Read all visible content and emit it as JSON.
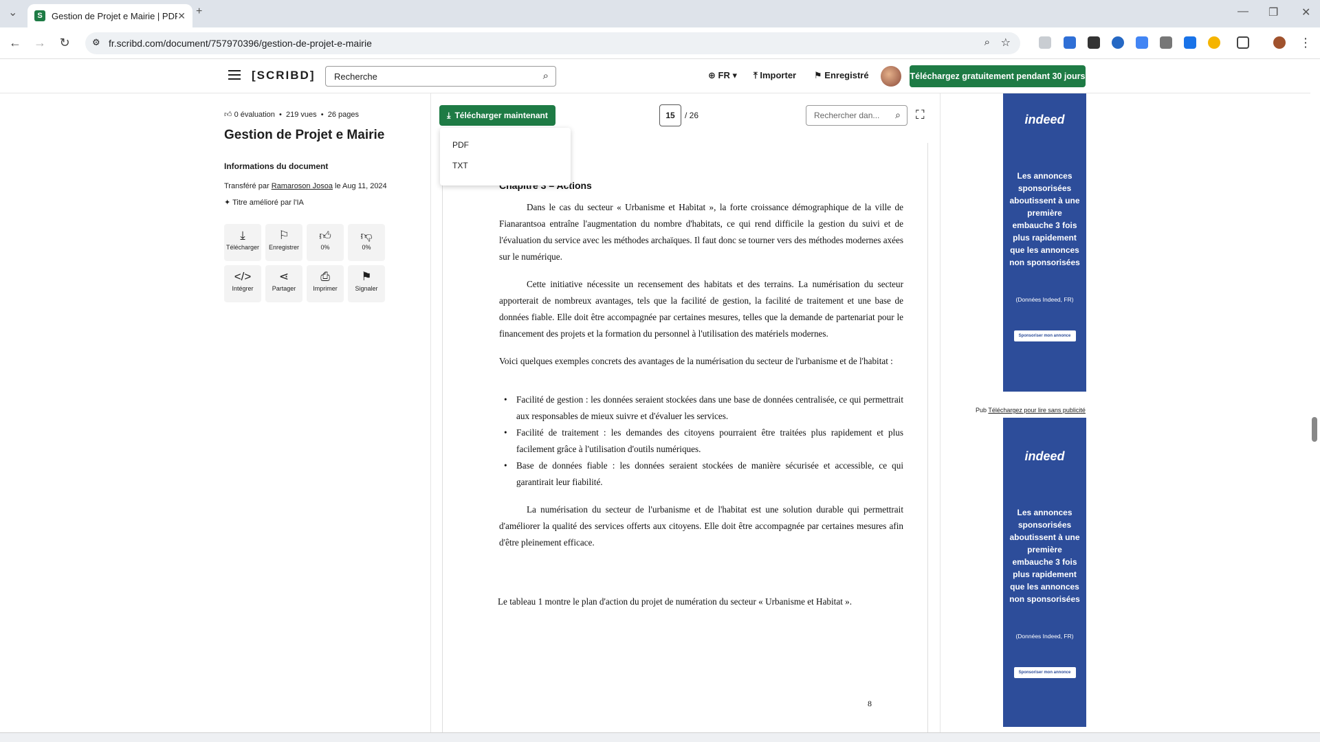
{
  "browser": {
    "tab_title": "Gestion de Projet e Mairie | PDF",
    "tab_favicon": "S",
    "url": "fr.scribd.com/document/757970396/gestion-de-projet-e-mairie"
  },
  "header": {
    "logo": "[SCRIBD]",
    "search_placeholder": "Recherche",
    "language": "FR",
    "import_label": "Importer",
    "saved_label": "Enregistré",
    "cta_label": "Téléchargez gratuitement pendant 30 jours"
  },
  "doc_info": {
    "rating": "0 évaluation",
    "views": "219 vues",
    "pages": "26 pages",
    "title": "Gestion de Projet e Mairie",
    "info_heading": "Informations du document",
    "uploader_prefix": "Transféré par",
    "uploader_name": "Ramaroson Josoa",
    "uploader_date": "le Aug 11, 2024",
    "ai_note": "Titre amélioré par l'IA"
  },
  "actions": [
    {
      "label": "Télécharger",
      "icon": "download-icon"
    },
    {
      "label": "Enregistrer",
      "icon": "bookmark-icon"
    },
    {
      "label": "0%",
      "icon": "thumbs-up-icon"
    },
    {
      "label": "0%",
      "icon": "thumbs-down-icon"
    },
    {
      "label": "Intégrer",
      "icon": "code-icon"
    },
    {
      "label": "Partager",
      "icon": "share-icon"
    },
    {
      "label": "Imprimer",
      "icon": "print-icon"
    },
    {
      "label": "Signaler",
      "icon": "flag-icon"
    }
  ],
  "viewer": {
    "download_button": "Télécharger maintenant",
    "download_options": [
      "PDF",
      "TXT"
    ],
    "current_page": "15",
    "total_pages": "/ 26",
    "search_placeholder": "Rechercher dan..."
  },
  "page": {
    "chapter": "Chapitre 3 – Actions",
    "paragraphs": [
      "Dans le cas du secteur « Urbanisme et Habitat », la forte croissance démographique de la ville de Fianarantsoa entraîne l'augmentation du nombre d'habitats, ce qui rend difficile la gestion du suivi et de l'évaluation du service avec les méthodes archaïques. Il faut donc se tourner vers des méthodes modernes axées sur le numérique.",
      "Cette initiative nécessite un recensement des habitats et des terrains. La numérisation du secteur apporterait de nombreux avantages, tels que la facilité de gestion, la facilité de traitement et une base de données fiable. Elle doit être accompagnée par certaines mesures, telles que la demande de partenariat pour le financement des projets et la formation du personnel à l'utilisation des matériels modernes.",
      "Voici quelques exemples concrets des avantages de la numérisation du secteur de l'urbanisme et de l'habitat :"
    ],
    "bullets": [
      "Facilité de gestion : les données seraient stockées dans une base de données centralisée, ce qui permettrait aux responsables de mieux suivre et d'évaluer les services.",
      "Facilité de traitement : les demandes des citoyens pourraient être traitées plus rapidement et plus facilement grâce à l'utilisation d'outils numériques.",
      "Base de données fiable : les données seraient stockées de manière sécurisée et accessible, ce qui garantirait leur fiabilité."
    ],
    "conclusion": "La numérisation du secteur de l'urbanisme et de l'habitat est une solution durable qui permettrait d'améliorer la qualité des services offerts aux citoyens. Elle doit être accompagnée par certaines mesures afin d'être pleinement efficace.",
    "table_ref": "Le tableau 1 montre le plan d'action du projet de numération du secteur « Urbanisme et Habitat ».",
    "page_number": "8"
  },
  "ads": {
    "brand": "indeed",
    "message": "Les annonces sponsorisées aboutissent à une première embauche 3 fois plus rapidement que les annonces non sponsorisées",
    "source": "(Données Indeed, FR)",
    "button": "Sponsoriser mon annonce",
    "pub_label": "Pub",
    "pub_link": "Téléchargez pour lire sans publicité"
  },
  "colors": {
    "brand_green": "#1e7b45",
    "ad_blue": "#2d4d9a"
  }
}
